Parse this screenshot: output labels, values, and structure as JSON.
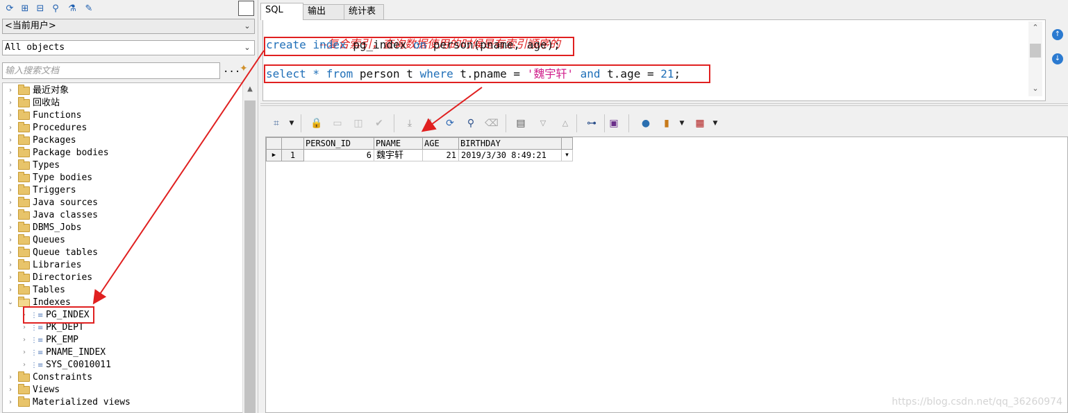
{
  "left_panel": {
    "user_combo": "<当前用户>",
    "objects_combo": "All objects",
    "search_placeholder": "输入搜索文档",
    "search_more": "...",
    "tree": [
      {
        "label": "最近对象"
      },
      {
        "label": "回收站"
      },
      {
        "label": "Functions"
      },
      {
        "label": "Procedures"
      },
      {
        "label": "Packages"
      },
      {
        "label": "Package bodies"
      },
      {
        "label": "Types"
      },
      {
        "label": "Type bodies"
      },
      {
        "label": "Triggers"
      },
      {
        "label": "Java sources"
      },
      {
        "label": "Java classes"
      },
      {
        "label": "DBMS_Jobs"
      },
      {
        "label": "Queues"
      },
      {
        "label": "Queue tables"
      },
      {
        "label": "Libraries"
      },
      {
        "label": "Directories"
      },
      {
        "label": "Tables"
      },
      {
        "label": "Indexes"
      }
    ],
    "indexes": [
      "PG_INDEX",
      "PK_DEPT",
      "PK_EMP",
      "PNAME_INDEX",
      "SYS_C0010011"
    ],
    "tree_after": [
      {
        "label": "Constraints"
      },
      {
        "label": "Views"
      },
      {
        "label": "Materialized views"
      }
    ]
  },
  "tabs": [
    "SQL",
    "输出",
    "统计表"
  ],
  "editor": {
    "comment": "--复合索引，查询数据使用的时候是有索引顺序的",
    "line1": {
      "kw1": "create",
      "kw2": "index",
      "t1": " pg_index ",
      "kw3": "on",
      "t2": " person(pname, age);"
    },
    "line2": {
      "kw1": "select",
      "op": " * ",
      "kw2": "from",
      "t1": " person t ",
      "kw3": "where",
      "t2": " t.pname = ",
      "str": "'魏宇轩'",
      "kw4": "and",
      "t3": " t.age = ",
      "num": "21",
      "t4": ";"
    }
  },
  "grid": {
    "columns": [
      "PERSON_ID",
      "PNAME",
      "AGE",
      "BIRTHDAY"
    ],
    "rows": [
      {
        "num": "1",
        "person_id": "6",
        "pname": "魏宇轩",
        "age": "21",
        "birthday": "2019/3/30 8:49:21"
      }
    ]
  },
  "watermark": "https://blog.csdn.net/qq_36260974",
  "colors": {
    "annotation": "#e02020",
    "keyword": "#1f6fb8",
    "string": "#d01d8a"
  }
}
